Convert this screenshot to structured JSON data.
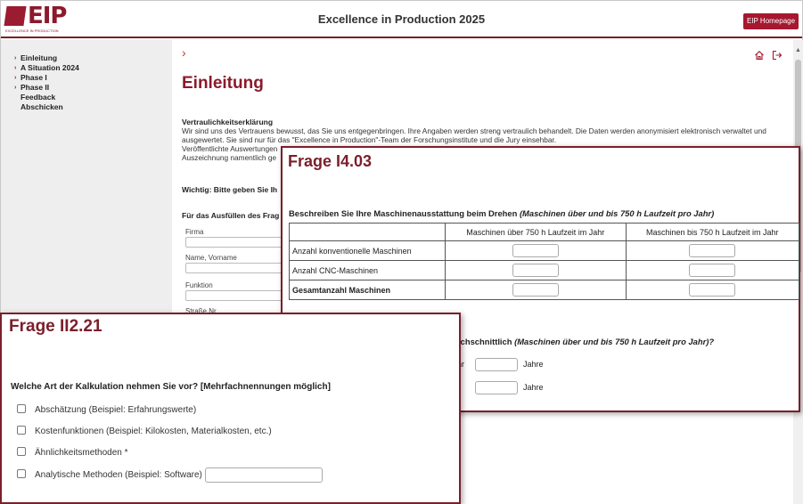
{
  "header": {
    "logo_text": "EIP",
    "logo_sub": "EXCELLENCE IN PRODUCTION",
    "title": "Excellence in Production 2025",
    "homepage_button": "EIP Homepage"
  },
  "sidebar": {
    "items": [
      {
        "label": "Einleitung",
        "arrow": "›"
      },
      {
        "label": "A Situation 2024",
        "arrow": "›"
      },
      {
        "label": "Phase I",
        "arrow": "›"
      },
      {
        "label": "Phase II",
        "arrow": "›"
      },
      {
        "label": "Feedback",
        "arrow": ""
      },
      {
        "label": "Abschicken",
        "arrow": ""
      }
    ]
  },
  "main": {
    "breadcrumb": "›",
    "heading": "Einleitung",
    "confidentiality_title": "Vertraulichkeitserklärung",
    "confidentiality_text": "Wir sind uns des Vertrauens bewusst, das Sie uns entgegenbringen. Ihre Angaben werden streng vertraulich behandelt. Die Daten werden anonymisiert elektronisch verwaltet und ausgewertet. Sie sind nur für das \"Excellence in Production\"-Team der Forschungsinstitute und die Jury einsehbar.",
    "published_line": "Veröffentlichte Auswertungen",
    "award_line": "Auszeichnung namentlich ge",
    "important": "Wichtig: Bitte geben Sie Ih",
    "fill_note": "Für das Ausfüllen des Frag",
    "fields": [
      {
        "label": "Firma"
      },
      {
        "label": "Name, Vorname"
      },
      {
        "label": "Funktion"
      },
      {
        "label": "Straße Nr."
      }
    ]
  },
  "card_i403": {
    "title": "Frage I4.03",
    "question_bold": "Beschreiben Sie Ihre Maschinenausstattung beim Drehen",
    "question_italic": "(Maschinen über und bis 750 h Laufzeit pro Jahr)",
    "columns": [
      "",
      "Maschinen über 750 h Laufzeit im Jahr",
      "Maschinen bis 750 h Laufzeit im Jahr"
    ],
    "rows": [
      {
        "label": "Anzahl konventionelle Maschinen",
        "over": "",
        "under": ""
      },
      {
        "label": "Anzahl CNC-Maschinen",
        "over": "",
        "under": ""
      },
      {
        "label": "Gesamtanzahl Maschinen",
        "over": "",
        "under": ""
      }
    ],
    "question2_bold": "rchschnittlich",
    "question2_italic": "(Maschinen über und bis 750 h Laufzeit pro Jahr)?",
    "years_prefix": "hr",
    "years_unit": "Jahre"
  },
  "card_ii221": {
    "title": "Frage II2.21",
    "question": "Welche Art der Kalkulation nehmen Sie vor? [Mehrfachnennungen möglich]",
    "options": [
      {
        "label": "Abschätzung (Beispiel: Erfahrungswerte)",
        "checked": false
      },
      {
        "label": "Kostenfunktionen (Beispiel: Kilokosten, Materialkosten, etc.)",
        "checked": false
      },
      {
        "label": "Ähnlichkeitsmethoden *",
        "checked": false
      },
      {
        "label": "Analytische Methoden (Beispiel: Software)",
        "checked": false
      }
    ]
  },
  "colors": {
    "accent": "#7a1f2b",
    "button": "#a5182f",
    "sidebar_bg": "#eeeeee"
  }
}
